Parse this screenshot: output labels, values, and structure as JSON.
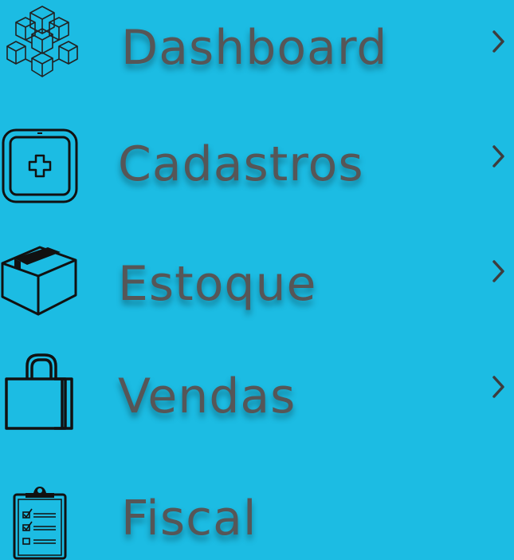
{
  "sidebar": {
    "items": [
      {
        "label": "Dashboard",
        "icon": "cubes-icon",
        "has_submenu": true
      },
      {
        "label": "Cadastros",
        "icon": "add-box-icon",
        "has_submenu": true
      },
      {
        "label": "Estoque",
        "icon": "package-box-icon",
        "has_submenu": true
      },
      {
        "label": "Vendas",
        "icon": "shopping-bag-icon",
        "has_submenu": true
      },
      {
        "label": "Fiscal",
        "icon": "clipboard-checklist-icon",
        "has_submenu": false
      }
    ]
  },
  "colors": {
    "background": "#1cbce3",
    "label_text": "#565657",
    "icon_stroke": "#111111"
  }
}
